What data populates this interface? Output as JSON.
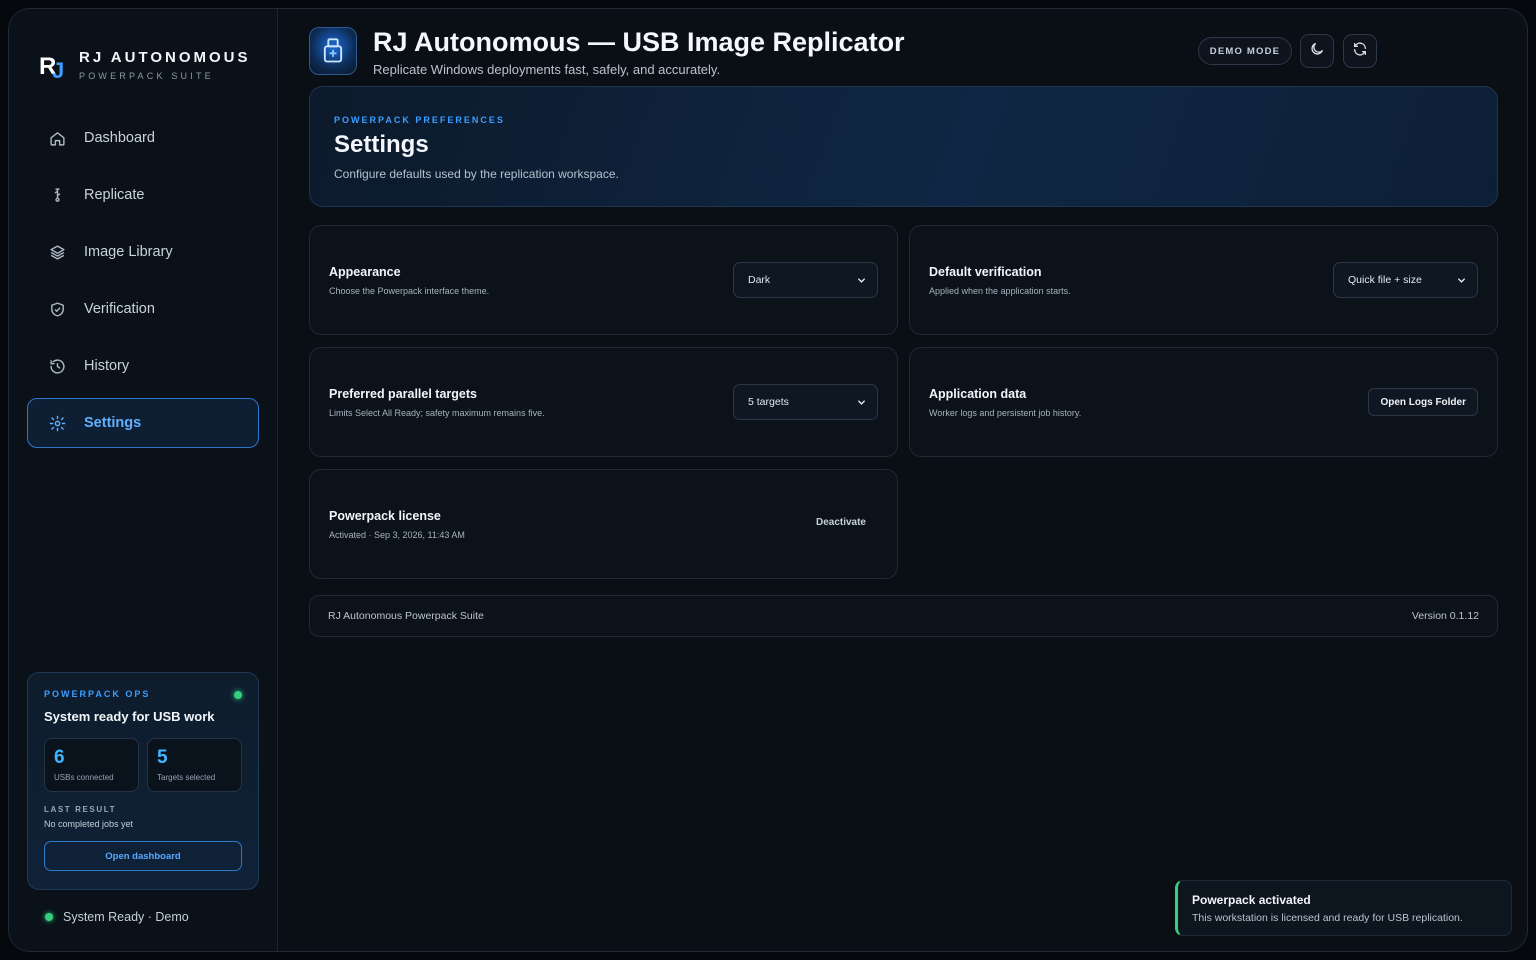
{
  "brand": {
    "name": "RJ AUTONOMOUS",
    "sub": "POWERPACK SUITE"
  },
  "nav": [
    {
      "label": "Dashboard",
      "icon": "home-icon"
    },
    {
      "label": "Replicate",
      "icon": "usb-icon"
    },
    {
      "label": "Image Library",
      "icon": "layers-icon"
    },
    {
      "label": "Verification",
      "icon": "shield-icon"
    },
    {
      "label": "History",
      "icon": "history-icon"
    },
    {
      "label": "Settings",
      "icon": "gear-icon",
      "active": true
    }
  ],
  "ops": {
    "eyebrow": "POWERPACK OPS",
    "title": "System ready for USB work",
    "usbs_count": "6",
    "usbs_label": "USBs connected",
    "targets_count": "5",
    "targets_label": "Targets selected",
    "last_label": "LAST RESULT",
    "last_value": "No completed jobs yet",
    "button": "Open dashboard"
  },
  "system_status": "System Ready · Demo",
  "header": {
    "title": "RJ Autonomous — USB Image Replicator",
    "subtitle": "Replicate Windows deployments fast, safely, and accurately.",
    "demo_badge": "DEMO MODE"
  },
  "hero": {
    "eyebrow": "POWERPACK PREFERENCES",
    "title": "Settings",
    "subtitle": "Configure defaults used by the replication workspace."
  },
  "cards": {
    "appearance": {
      "title": "Appearance",
      "desc": "Choose the Powerpack interface theme.",
      "value": "Dark"
    },
    "verification": {
      "title": "Default verification",
      "desc": "Applied when the application starts.",
      "value": "Quick file + size"
    },
    "parallel": {
      "title": "Preferred parallel targets",
      "desc": "Limits Select All Ready; safety maximum remains five.",
      "value": "5 targets"
    },
    "appdata": {
      "title": "Application data",
      "desc": "Worker logs and persistent job history.",
      "button": "Open Logs Folder"
    },
    "license": {
      "title": "Powerpack license",
      "desc": "Activated · Sep 3, 2026, 11:43 AM",
      "button": "Deactivate"
    }
  },
  "footer": {
    "suite": "RJ Autonomous Powerpack Suite",
    "version": "Version 0.1.12"
  },
  "toast": {
    "title": "Powerpack activated",
    "message": "This workstation is licensed and ready for USB replication."
  },
  "colors": {
    "accent": "#3c9dff",
    "success": "#35d07f",
    "background": "#0a0f16"
  }
}
